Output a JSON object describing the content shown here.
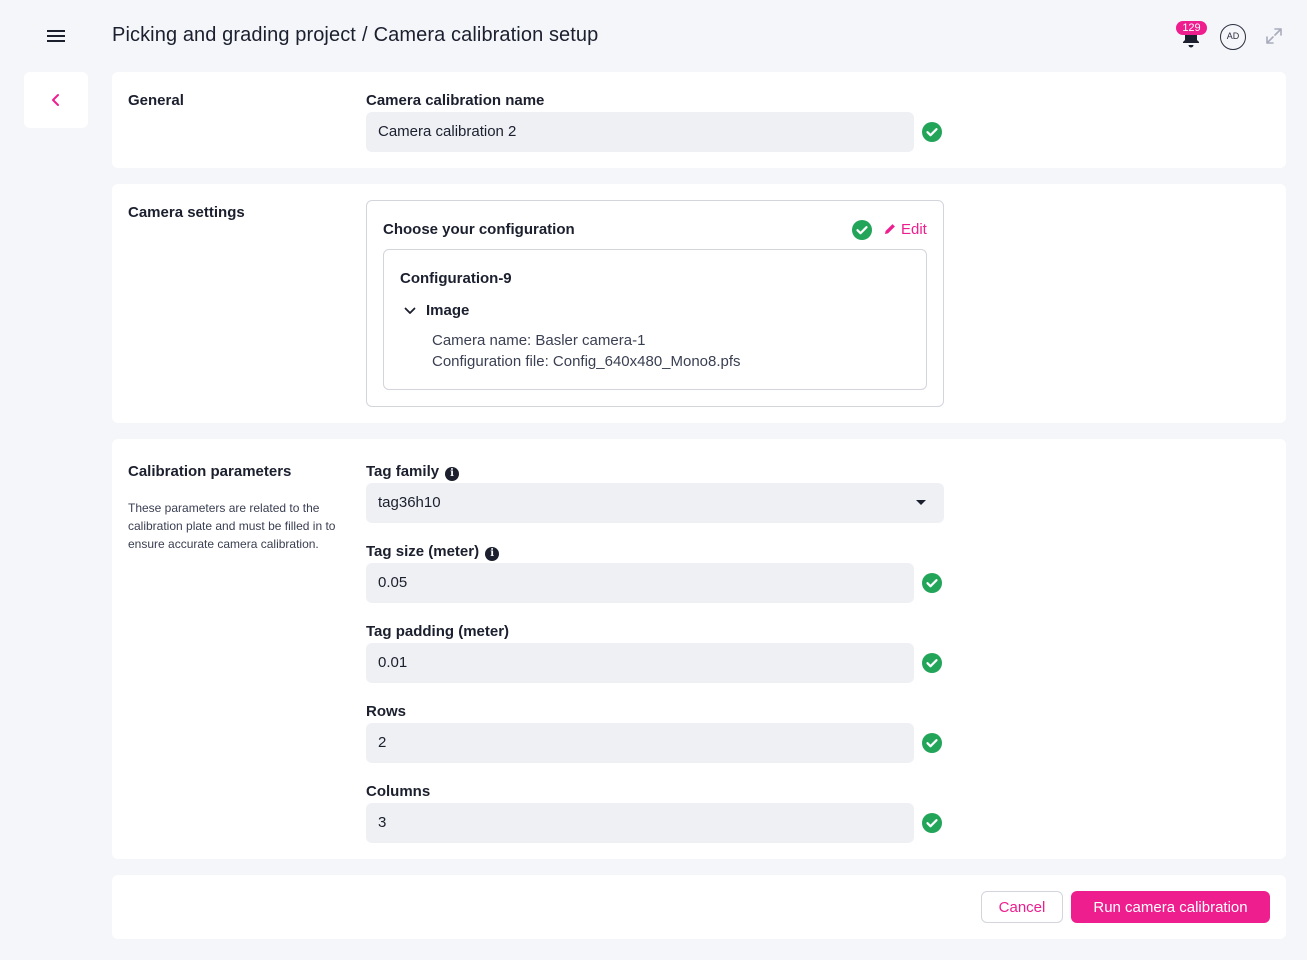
{
  "header": {
    "breadcrumb_project": "Picking and grading project",
    "breadcrumb_separator": "/",
    "breadcrumb_page": "Camera calibration setup",
    "notification_count": "129",
    "avatar_initials": "AD"
  },
  "icons": {
    "menu": "hamburger-menu-icon",
    "back": "chevron-left-icon",
    "notifications": "bell-icon",
    "expand": "expand-icon",
    "valid": "check-circle-icon",
    "edit": "pencil-icon",
    "info": "info-icon",
    "collapse": "chevron-down-icon",
    "dropdown": "caret-down-icon"
  },
  "colors": {
    "accent": "#ef1e8e",
    "success": "#22a559",
    "background": "#f5f6fa",
    "input_bg": "#eff0f4"
  },
  "general": {
    "section_title": "General",
    "name_label": "Camera calibration name",
    "name_value": "Camera calibration 2"
  },
  "camera_settings": {
    "section_title": "Camera settings",
    "choose_label": "Choose your configuration",
    "edit_label": "Edit",
    "configuration_name": "Configuration-9",
    "image_label": "Image",
    "camera_name": "Camera name: Basler camera-1",
    "configuration_file": "Configuration file: Config_640x480_Mono8.pfs"
  },
  "calibration": {
    "section_title": "Calibration parameters",
    "description": "These parameters are related to the calibration plate and must be filled in to ensure accurate camera calibration.",
    "tag_family_label": "Tag family",
    "tag_family_value": "tag36h10",
    "tag_size_label": "Tag size (meter)",
    "tag_size_value": "0.05",
    "tag_padding_label": "Tag padding (meter)",
    "tag_padding_value": "0.01",
    "rows_label": "Rows",
    "rows_value": "2",
    "columns_label": "Columns",
    "columns_value": "3"
  },
  "actions": {
    "cancel_label": "Cancel",
    "run_label": "Run camera calibration"
  }
}
